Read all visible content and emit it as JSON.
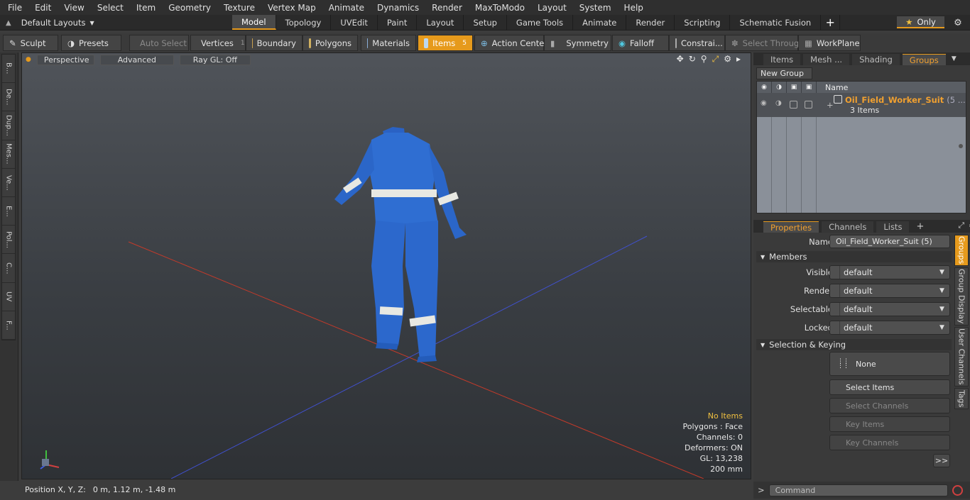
{
  "menu": [
    "File",
    "Edit",
    "View",
    "Select",
    "Item",
    "Geometry",
    "Texture",
    "Vertex Map",
    "Animate",
    "Dynamics",
    "Render",
    "MaxToModo",
    "Layout",
    "System",
    "Help"
  ],
  "layouts": {
    "label": "Default Layouts"
  },
  "mode_tabs": [
    "Model",
    "Topology",
    "UVEdit",
    "Paint",
    "Layout",
    "Setup",
    "Game Tools",
    "Animate",
    "Render",
    "Scripting",
    "Schematic Fusion"
  ],
  "active_mode_tab": "Model",
  "only_label": "Only",
  "toolbar": {
    "sculpt": "Sculpt",
    "presets": "Presets",
    "auto_select": "Auto Select",
    "vertices": "Vertices",
    "vertices_count": "1",
    "boundary": "Boundary",
    "polygons": "Polygons",
    "materials": "Materials",
    "items": "Items",
    "items_count": "5",
    "action_center": "Action Center",
    "symmetry": "Symmetry",
    "falloff": "Falloff",
    "constraints": "Constrai...",
    "select_through": "Select Through",
    "workplane": "WorkPlane"
  },
  "left_tabs": [
    "B...",
    "De...",
    "Dup...",
    "Mes...",
    "Ve...",
    "E...",
    "Pol...",
    "C...",
    "UV",
    "F..."
  ],
  "viewport": {
    "view": "Perspective",
    "advanced": "Advanced",
    "raygl": "Ray GL: Off",
    "info": {
      "selection": "No Items",
      "polygons": "Polygons : Face",
      "channels": "Channels: 0",
      "deformers": "Deformers: ON",
      "gl": "GL: 13,238",
      "scale": "200 mm"
    }
  },
  "position": {
    "label": "Position X, Y, Z:",
    "value": "0 m, 1.12 m, -1.48 m"
  },
  "scene_panel": {
    "tabs": [
      "Items",
      "Mesh ...",
      "Shading",
      "Groups"
    ],
    "active_tab": "Groups",
    "new_group": "New Group",
    "name_header": "Name",
    "group_name": "Oil_Field_Worker_Suit",
    "group_suffix": "(5 ...",
    "group_count": "3 Items"
  },
  "props_panel": {
    "tabs": [
      "Properties",
      "Channels",
      "Lists"
    ],
    "active_tab": "Properties",
    "name_label": "Name",
    "name_value": "Oil_Field_Worker_Suit (5)",
    "members_label": "Members",
    "rows": [
      {
        "label": "Visible",
        "value": "default"
      },
      {
        "label": "Render",
        "value": "default"
      },
      {
        "label": "Selectable",
        "value": "default"
      },
      {
        "label": "Locked",
        "value": "default"
      }
    ],
    "sel_keying_label": "Selection & Keying",
    "none_label": "None",
    "select_items": "Select Items",
    "select_channels": "Select Channels",
    "key_items": "Key Items",
    "key_channels": "Key Channels",
    "more": ">>"
  },
  "side_tabs": [
    "Groups",
    "Group Display",
    "User Channels",
    "Tags"
  ],
  "command": {
    "placeholder": "Command"
  },
  "colors": {
    "accent": "#e69a1c",
    "suit_blue": "#2e6fd4",
    "reflective": "#e6e6e0",
    "x_axis": "#d04030",
    "z_axis": "#4050d0"
  }
}
